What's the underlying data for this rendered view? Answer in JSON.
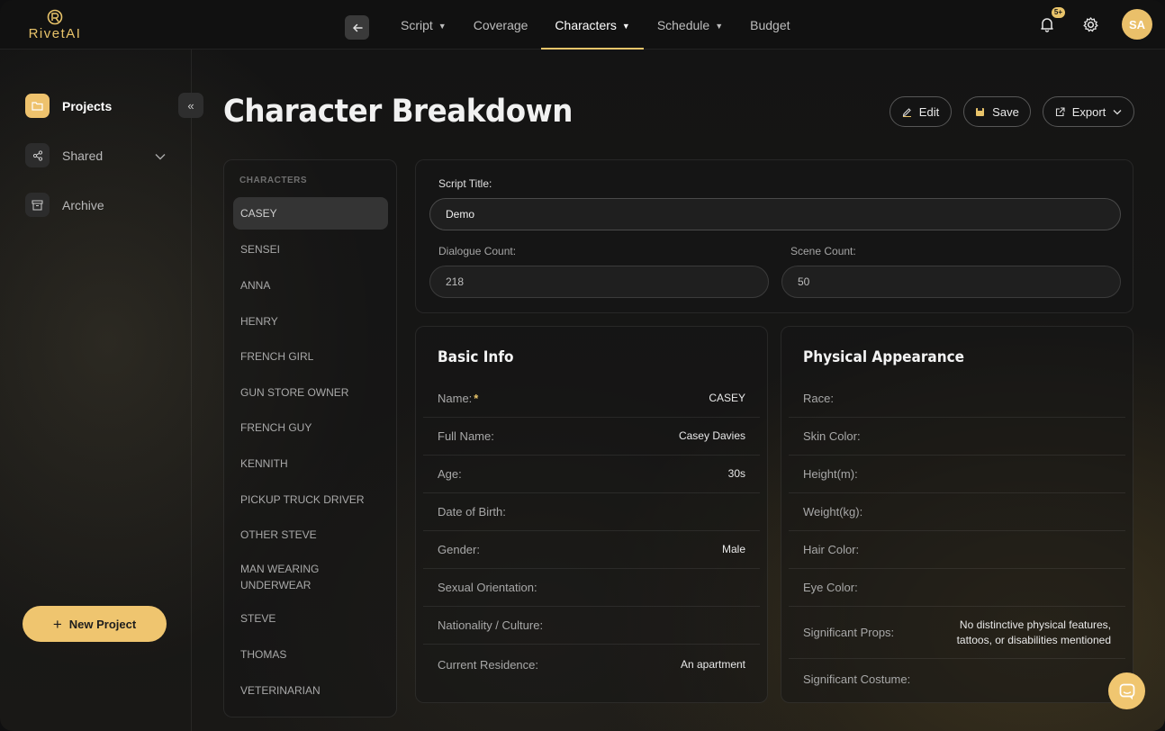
{
  "app": {
    "brand": "RivetAI"
  },
  "nav": {
    "items": [
      {
        "label": "Script",
        "dropdown": true
      },
      {
        "label": "Coverage",
        "dropdown": false
      },
      {
        "label": "Characters",
        "dropdown": true,
        "active": true
      },
      {
        "label": "Schedule",
        "dropdown": true
      },
      {
        "label": "Budget",
        "dropdown": false
      }
    ],
    "notifications_badge": "5+",
    "avatar_initials": "SA"
  },
  "sidebar": {
    "items": [
      {
        "label": "Projects",
        "icon": "folder-icon",
        "active": true
      },
      {
        "label": "Shared",
        "icon": "share-icon"
      },
      {
        "label": "Archive",
        "icon": "archive-icon"
      }
    ],
    "new_project_label": "New Project"
  },
  "page": {
    "title": "Character Breakdown",
    "actions": {
      "edit": "Edit",
      "save": "Save",
      "export": "Export"
    }
  },
  "characters": {
    "heading": "CHARACTERS",
    "items": [
      "CASEY",
      "SENSEI",
      "ANNA",
      "HENRY",
      "FRENCH GIRL",
      "GUN STORE OWNER",
      "FRENCH GUY",
      "KENNITH",
      "PICKUP TRUCK DRIVER",
      "OTHER STEVE",
      "MAN WEARING UNDERWEAR",
      "STEVE",
      "THOMAS",
      "VETERINARIAN"
    ],
    "selected": "CASEY"
  },
  "script_info": {
    "script_title_label": "Script Title:",
    "script_title_value": "Demo",
    "dialogue_count_label": "Dialogue Count:",
    "dialogue_count_value": "218",
    "scene_count_label": "Scene Count:",
    "scene_count_value": "50"
  },
  "basic_info": {
    "title": "Basic Info",
    "rows": [
      {
        "label": "Name:",
        "value": "CASEY",
        "required": true
      },
      {
        "label": "Full Name:",
        "value": "Casey Davies"
      },
      {
        "label": "Age:",
        "value": "30s"
      },
      {
        "label": "Date of Birth:",
        "value": ""
      },
      {
        "label": "Gender:",
        "value": "Male"
      },
      {
        "label": "Sexual Orientation:",
        "value": ""
      },
      {
        "label": "Nationality / Culture:",
        "value": ""
      },
      {
        "label": "Current Residence:",
        "value": "An apartment"
      }
    ],
    "required_mark": "*"
  },
  "physical_appearance": {
    "title": "Physical Appearance",
    "rows": [
      {
        "label": "Race:",
        "value": ""
      },
      {
        "label": "Skin Color:",
        "value": ""
      },
      {
        "label": "Height(m):",
        "value": ""
      },
      {
        "label": "Weight(kg):",
        "value": ""
      },
      {
        "label": "Hair Color:",
        "value": ""
      },
      {
        "label": "Eye Color:",
        "value": ""
      },
      {
        "label": "Significant Props:",
        "value": "No distinctive physical features, tattoos, or disabilities mentioned"
      },
      {
        "label": "Significant Costume:",
        "value": ""
      }
    ]
  },
  "colors": {
    "accent": "#e9c46a",
    "background": "#151515"
  }
}
